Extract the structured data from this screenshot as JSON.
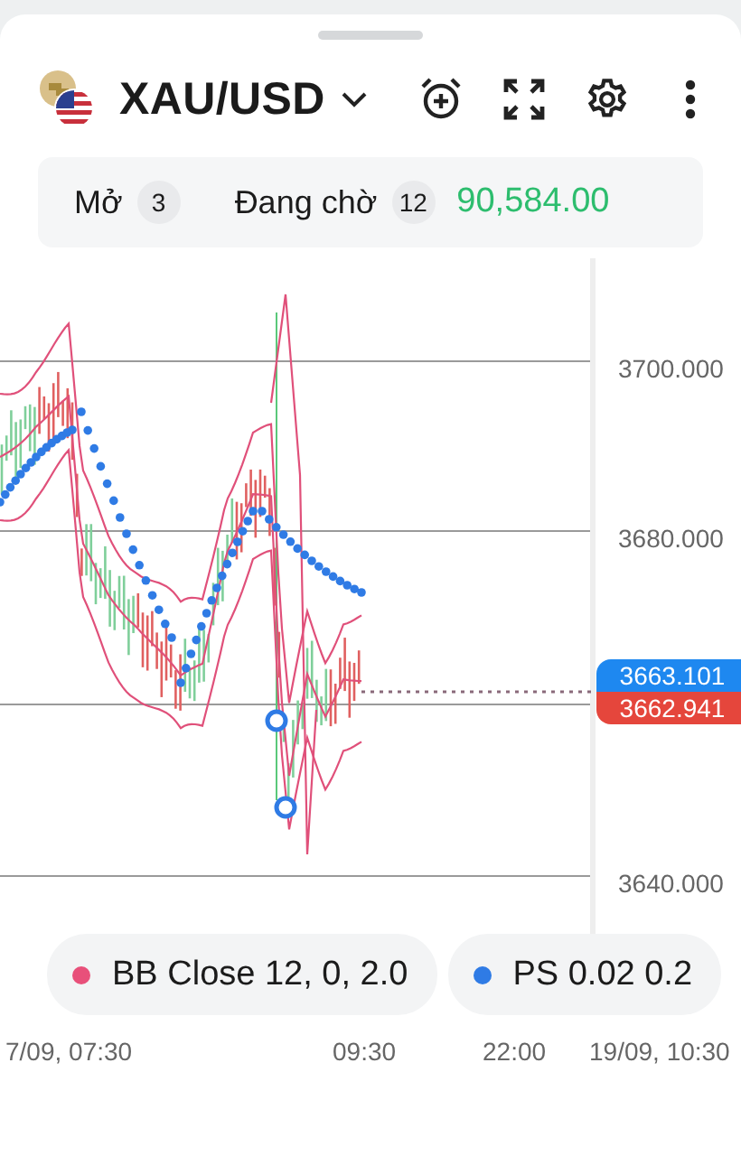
{
  "header": {
    "symbol": "XAU/USD"
  },
  "stats": {
    "items": [
      {
        "label": "Mở",
        "count": "3"
      },
      {
        "label": "Đang chờ",
        "count": "12"
      }
    ],
    "balance": "90,584.00"
  },
  "chart": {
    "y_axis_labels": [
      "3700.000",
      "3680.000",
      "3640.000"
    ],
    "price_tags": [
      {
        "kind": "ask",
        "value": "3663.101"
      },
      {
        "kind": "bid",
        "value": "3662.941"
      }
    ],
    "x_axis_labels": [
      "7/09, 07:30",
      "09:30",
      "22:00",
      "19/09, 10:30"
    ]
  },
  "indicators": [
    {
      "label": "BB Close 12, 0, 2.0",
      "color": "#e8507a"
    },
    {
      "label": "PS 0.02 0.2",
      "color": "#2f7be5"
    }
  ]
}
